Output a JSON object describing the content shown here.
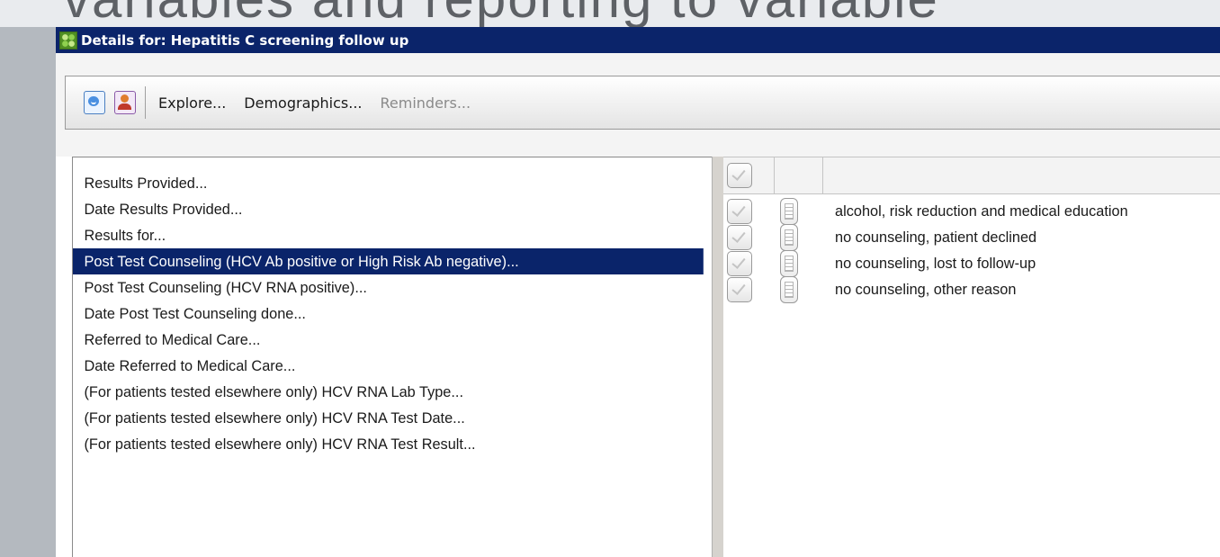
{
  "slide": {
    "title_fragment": "variables and reporting to variable"
  },
  "window": {
    "title": "Details for: Hepatitis C screening follow up"
  },
  "toolbar": {
    "icons": [
      "chart-icon",
      "person-icon"
    ],
    "explore_label": "Explore...",
    "demographics_label": "Demographics...",
    "reminders_label": "Reminders..."
  },
  "fields": {
    "items": [
      "Results Provided...",
      "Date Results Provided...",
      "Results for...",
      "Post Test Counseling (HCV Ab positive or High Risk Ab negative)...",
      "Post Test Counseling (HCV RNA positive)...",
      "Date Post Test Counseling done...",
      "Referred to Medical Care...",
      "Date Referred to Medical Care...",
      "(For patients tested elsewhere only) HCV RNA Lab Type...",
      "(For patients tested elsewhere only) HCV RNA Test Date...",
      "(For patients tested elsewhere only) HCV RNA Test Result..."
    ],
    "selected_index": 3
  },
  "options": {
    "rows": [
      "alcohol, risk reduction and medical education",
      "no counseling, patient declined",
      "no counseling, lost to follow-up",
      "no counseling, other reason"
    ]
  }
}
